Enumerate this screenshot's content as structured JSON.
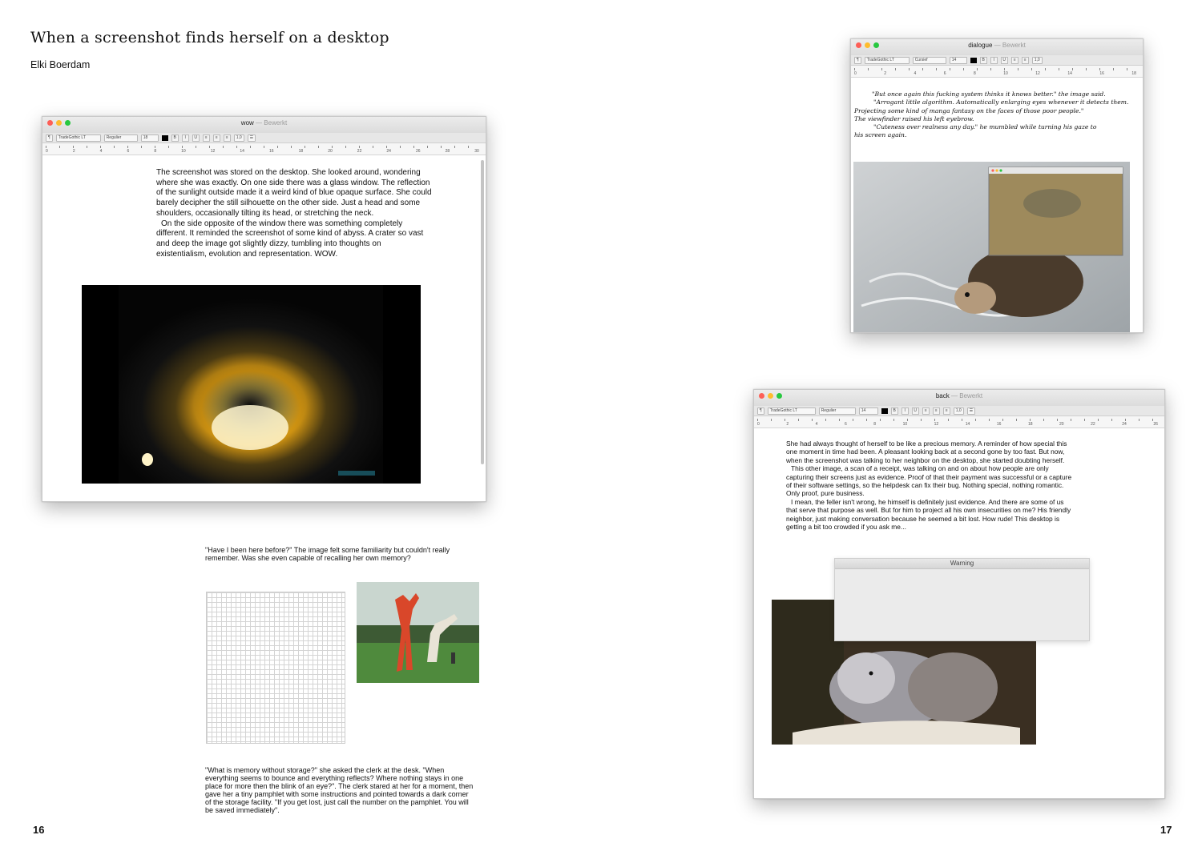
{
  "article": {
    "title": "When a screenshot finds herself on a desktop",
    "author": "Elki Boerdam"
  },
  "page_numbers": {
    "left": "16",
    "right": "17"
  },
  "windows": {
    "wow": {
      "doc_name": "wow",
      "app_name": "Bewerkt",
      "toolbar": {
        "paragraph": "¶",
        "font": "TradeGothic LT",
        "style": "Regulier",
        "size": "18",
        "spacing": "1,0"
      },
      "ruler": [
        "0",
        "2",
        "4",
        "6",
        "8",
        "10",
        "12",
        "14",
        "16",
        "18",
        "20",
        "22",
        "24",
        "26",
        "28",
        "30"
      ],
      "paragraphs": [
        "The screenshot was stored on the desktop. She looked around, wondering where she was exactly. On one side there was a glass window. The reflection of the sunlight outside made it a weird kind of blue opaque surface. She could barely decipher the still silhouette on the other side. Just a head and some shoulders, occasionally tilting its head, or stretching the neck.",
        "On the side opposite of the window there was something completely different. It reminded the screenshot of some kind of abyss. A crater so vast and deep the image got slightly dizzy, tumbling into thoughts on existentialism, evolution and representation. WOW."
      ]
    },
    "dialogue": {
      "doc_name": "dialogue",
      "app_name": "Bewerkt",
      "toolbar": {
        "paragraph": "¶",
        "font": "TradeGothic LT",
        "style": "Cursief",
        "size": "14",
        "spacing": "1,0"
      },
      "ruler": [
        "0",
        "2",
        "4",
        "6",
        "8",
        "10",
        "12",
        "14",
        "16",
        "18"
      ],
      "lines": [
        "\"But once again this fucking system thinks it knows better.\" the image said.",
        "\"Arrogant little algorithm. Automatically enlarging eyes whenever it detects them.",
        "Projecting some kind of manga fantasy on the faces of those poor people.\"",
        "The viewfinder raised his left eyebrow.",
        "\"Cuteness over realness any day.\" he mumbled while turning his gaze to",
        "his screen again."
      ]
    },
    "back": {
      "doc_name": "back",
      "app_name": "Bewerkt",
      "toolbar": {
        "paragraph": "¶",
        "font": "TradeGothic LT",
        "style": "Regulier",
        "size": "14",
        "spacing": "1,0"
      },
      "ruler": [
        "0",
        "2",
        "4",
        "6",
        "8",
        "10",
        "12",
        "14",
        "16",
        "18",
        "20",
        "22",
        "24",
        "26"
      ],
      "paragraphs": [
        "She had always thought of herself to be like a precious memory. A reminder of how special this one moment in time had been. A pleasant looking back at a second gone by too fast. But now, when the screenshot was talking to her neighbor on the desktop, she started doubting herself.",
        "This other image, a scan of a receipt, was talking on and on about how people are only capturing their screens just as evidence. Proof of that their payment was successful or a capture of their software settings, so the helpdesk can fix their bug. Nothing special, nothing romantic. Only proof, pure business.",
        "I mean, the feller isn't wrong, he himself is definitely just evidence. And there are some of us that serve that purpose as well. But for him to project all his own insecurities on me? His friendly neighbor, just making conversation because he seemed a bit lost. How rude! This desktop is getting a bit too crowded if you ask me..."
      ],
      "warning_title": "Warning"
    }
  },
  "captions": {
    "memory_question": "\"Have I been here before?\" The image felt some familiarity but couldn't really remember. Was she even capable of recalling her own memory?",
    "storage": "\"What is memory without storage?\" she asked the clerk at the desk. \"When everything seems to bounce and everything reflects? Where nothing stays in one place for more then the blink of an eye?\". The clerk stared at her for a moment, then gave her a tiny pamphlet with some instructions and pointed towards a dark corner of the storage facility. \"If you get lost, just call the number on the pamphlet. You will be saved immediately\"."
  },
  "colors": {
    "close": "#fd5f57",
    "minimize": "#febc2e",
    "maximize": "#28c840"
  }
}
